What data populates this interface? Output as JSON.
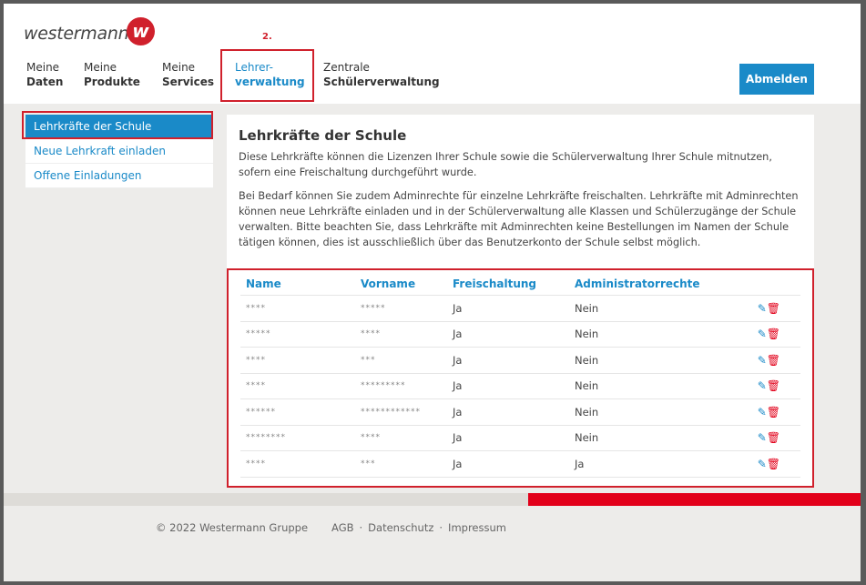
{
  "brand": {
    "name": "westermann",
    "logo_letter": "w",
    "color": "#d0202c"
  },
  "annotation": "2.",
  "nav": [
    {
      "top": "Meine",
      "bottom": "Daten"
    },
    {
      "top": "Meine",
      "bottom": "Produkte"
    },
    {
      "top": "Meine",
      "bottom": "Services"
    },
    {
      "top": "Lehrer-",
      "bottom": "verwaltung",
      "active": true
    },
    {
      "top": "Zentrale",
      "bottom": "Schülerverwaltung"
    }
  ],
  "logout_label": "Abmelden",
  "sidebar": [
    {
      "label": "Lehrkräfte der Schule",
      "selected": true
    },
    {
      "label": "Neue Lehrkraft einladen"
    },
    {
      "label": "Offene Einladungen"
    }
  ],
  "main": {
    "title": "Lehrkräfte der Schule",
    "p1": "Diese Lehrkräfte können die Lizenzen Ihrer Schule sowie die Schülerverwaltung Ihrer Schule mitnutzen, sofern eine Freischaltung durchgeführt wurde.",
    "p2": "Bei Bedarf können Sie zudem Adminrechte für einzelne Lehrkräfte freischalten. Lehrkräfte mit Adminrechten können neue Lehrkräfte einladen und in der Schülerverwaltung alle Klassen und Schülerzugänge der Schule verwalten. Bitte beachten Sie, dass Lehrkräfte mit Adminrechten keine Bestellungen im Namen der Schule tätigen können, dies ist ausschließlich über das Benutzerkonto der Schule selbst möglich."
  },
  "table": {
    "headers": [
      "Name",
      "Vorname",
      "Freischaltung",
      "Administratorrechte"
    ],
    "rows": [
      [
        "****",
        "*****",
        "Ja",
        "Nein"
      ],
      [
        "*****",
        "****",
        "Ja",
        "Nein"
      ],
      [
        "****",
        "***",
        "Ja",
        "Nein"
      ],
      [
        "****",
        "*********",
        "Ja",
        "Nein"
      ],
      [
        "******",
        "************",
        "Ja",
        "Nein"
      ],
      [
        "********",
        "****",
        "Ja",
        "Nein"
      ],
      [
        "****",
        "***",
        "Ja",
        "Ja"
      ]
    ],
    "icons": [
      "pencil-icon",
      "trash-icon"
    ]
  },
  "footer": {
    "copyright": "© 2022 Westermann Gruppe",
    "links": [
      "AGB",
      "·",
      "Datenschutz",
      "·",
      "Impressum"
    ]
  },
  "colors": {
    "accent": "#1a8ac8",
    "red": "#e2001a"
  }
}
